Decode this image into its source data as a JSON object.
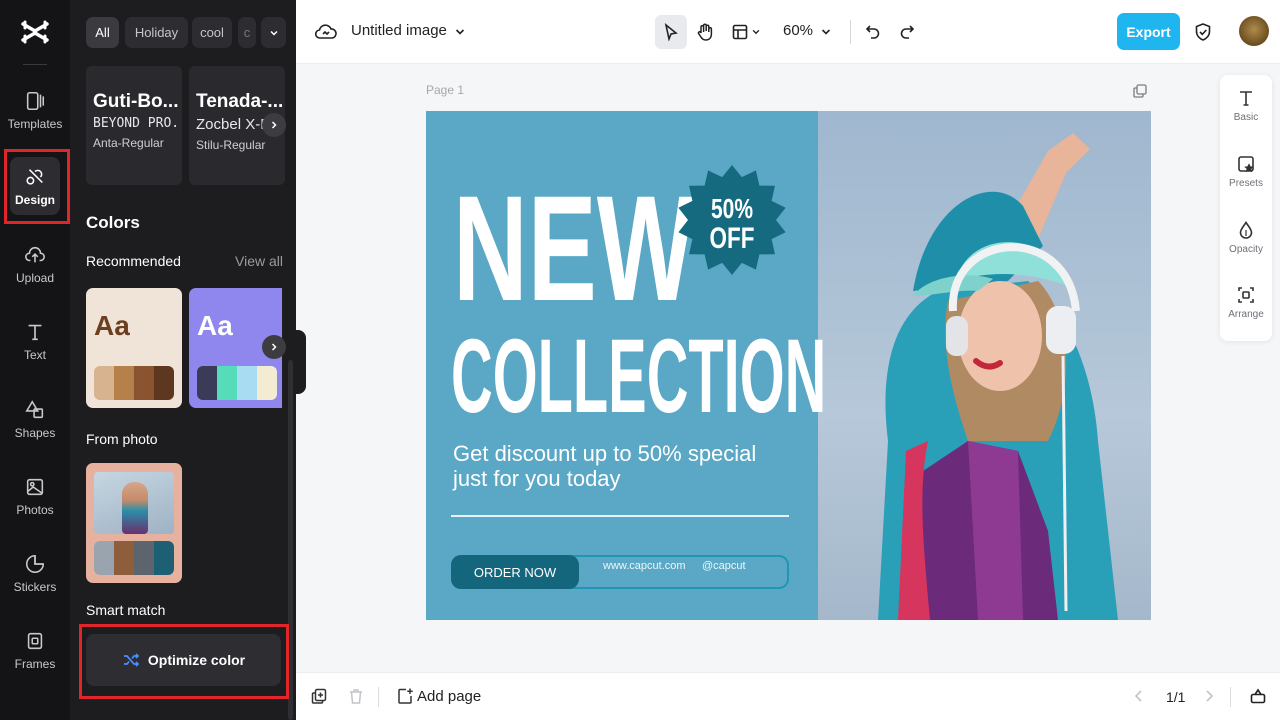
{
  "rail": {
    "items": [
      {
        "label": "Templates",
        "icon": "templates-icon"
      },
      {
        "label": "Design",
        "icon": "design-icon"
      },
      {
        "label": "Upload",
        "icon": "upload-icon"
      },
      {
        "label": "Text",
        "icon": "text-icon"
      },
      {
        "label": "Shapes",
        "icon": "shapes-icon"
      },
      {
        "label": "Photos",
        "icon": "photos-icon"
      },
      {
        "label": "Stickers",
        "icon": "stickers-icon"
      },
      {
        "label": "Frames",
        "icon": "frames-icon"
      }
    ]
  },
  "panel": {
    "chips": [
      "All",
      "Holiday",
      "cool",
      "c"
    ],
    "fonts": [
      {
        "line1": "Guti-Bo...",
        "line2": "BEYOND PRO...",
        "line3": "Anta-Regular"
      },
      {
        "line1": "Tenada-...",
        "line2": "Zocbel X-E",
        "line3": "Stilu-Regular"
      }
    ],
    "colors_heading": "Colors",
    "recommended": "Recommended",
    "view_all": "View all",
    "palettes": [
      {
        "sample": "Aa",
        "bg": "#efe4d7",
        "text": "#6b3f1f",
        "swatches": [
          "#d7b48f",
          "#b58049",
          "#8a5430",
          "#5e3720"
        ]
      },
      {
        "sample": "Aa",
        "bg": "#8f86ee",
        "text": "#ffffff",
        "swatches": [
          "#3c3b57",
          "#55dcb8",
          "#a8dcf2",
          "#f4ecd2"
        ]
      }
    ],
    "from_photo": "From photo",
    "photo_palette": {
      "bg": "#e7b19f",
      "swatches": [
        "#9aa4ae",
        "#8e5e3c",
        "#5c646e",
        "#1d5f73"
      ]
    },
    "smart_match": "Smart match",
    "optimize": "Optimize color"
  },
  "topbar": {
    "title": "Untitled image",
    "zoom": "60%",
    "export": "Export"
  },
  "canvas": {
    "page_label": "Page 1",
    "headline1": "NEW",
    "headline2": "COLLECTION",
    "badge_line1": "50%",
    "badge_line2": "OFF",
    "tagline": "Get discount up to 50% special just for you today",
    "order": "ORDER NOW",
    "website": "www.capcut.com",
    "handle": "@capcut"
  },
  "props": [
    {
      "label": "Basic",
      "icon": "text-icon"
    },
    {
      "label": "Presets",
      "icon": "presets-icon"
    },
    {
      "label": "Opacity",
      "icon": "opacity-icon"
    },
    {
      "label": "Arrange",
      "icon": "arrange-icon"
    }
  ],
  "bottombar": {
    "add_page": "Add page",
    "page_count": "1/1"
  },
  "colors": {
    "accent": "#1fb6f0",
    "highlight_box": "#e0262b",
    "canvas_bg": "#5aa8c6",
    "badge": "#166a80"
  }
}
